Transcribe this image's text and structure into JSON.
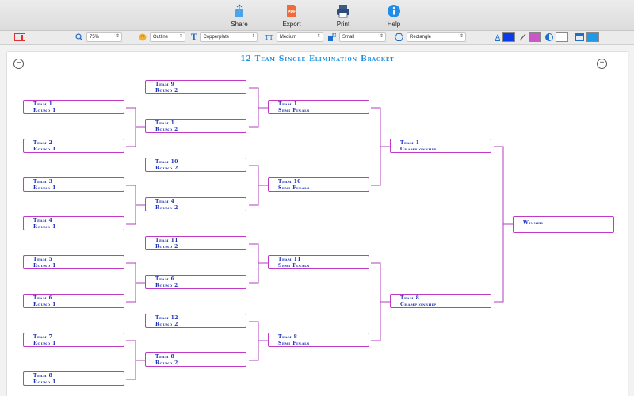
{
  "toolbar": {
    "buttons": [
      {
        "name": "share-button",
        "icon": "share-icon",
        "label": "Share"
      },
      {
        "name": "export-button",
        "icon": "pdf-export-icon",
        "label": "Export"
      },
      {
        "name": "print-button",
        "icon": "printer-icon",
        "label": "Print"
      },
      {
        "name": "help-button",
        "icon": "info-icon",
        "label": "Help"
      }
    ]
  },
  "formatbar": {
    "zoom": "75%",
    "style": "Outline",
    "font": "Copperplate",
    "weight": "Medium",
    "size": "Small",
    "shape": "Rectangle",
    "colors": {
      "text": "#0a3de8",
      "line": "#c857c8",
      "fill": "#ffffff",
      "accent": "#1e9be8"
    }
  },
  "canvas": {
    "title": "12 Team Single Elimination Bracket",
    "zoom_out_symbol": "−",
    "zoom_in_symbol": "+"
  },
  "bracket": {
    "round1": [
      {
        "line1": "Team 1",
        "line2": "Round 1"
      },
      {
        "line1": "Team 2",
        "line2": "Round 1"
      },
      {
        "line1": "Team 3",
        "line2": "Round 1"
      },
      {
        "line1": "Team 4",
        "line2": "Round 1"
      },
      {
        "line1": "Team 5",
        "line2": "Round 1"
      },
      {
        "line1": "Team 6",
        "line2": "Round 1"
      },
      {
        "line1": "Team 7",
        "line2": "Round 1"
      },
      {
        "line1": "Team 8",
        "line2": "Round 1"
      }
    ],
    "round2": [
      {
        "line1": "Team 9",
        "line2": "Round 2"
      },
      {
        "line1": "Team 1",
        "line2": "Round 2"
      },
      {
        "line1": "Team 10",
        "line2": "Round 2"
      },
      {
        "line1": "Team 4",
        "line2": "Round 2"
      },
      {
        "line1": "Team 11",
        "line2": "Round 2"
      },
      {
        "line1": "Team 6",
        "line2": "Round 2"
      },
      {
        "line1": "Team 12",
        "line2": "Round 2"
      },
      {
        "line1": "Team 8",
        "line2": "Round 2"
      }
    ],
    "semis": [
      {
        "line1": "Team 1",
        "line2": "Semi Finals"
      },
      {
        "line1": "Team 10",
        "line2": "Semi Finals"
      },
      {
        "line1": "Team 11",
        "line2": "Semi Finals"
      },
      {
        "line1": "Team 8",
        "line2": "Semi Finals"
      }
    ],
    "championship": [
      {
        "line1": "Team 1",
        "line2": "Championship"
      },
      {
        "line1": "Team 8",
        "line2": "Championship"
      }
    ],
    "winner": {
      "line1": "Winner"
    }
  }
}
